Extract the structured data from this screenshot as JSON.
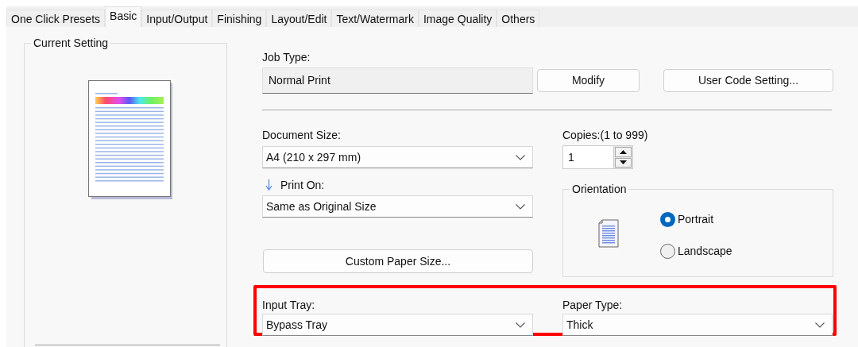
{
  "tabs": [
    {
      "label": "One Click Presets",
      "selected": false
    },
    {
      "label": "Basic",
      "selected": true
    },
    {
      "label": "Input/Output",
      "selected": false
    },
    {
      "label": "Finishing",
      "selected": false
    },
    {
      "label": "Layout/Edit",
      "selected": false
    },
    {
      "label": "Text/Watermark",
      "selected": false
    },
    {
      "label": "Image Quality",
      "selected": false
    },
    {
      "label": "Others",
      "selected": false
    }
  ],
  "current_setting": {
    "title": "Current Setting"
  },
  "job_type": {
    "label": "Job Type:",
    "value": "Normal Print",
    "buttons": [
      "Modify",
      "User Code Setting..."
    ]
  },
  "document_size": {
    "label": "Document Size:",
    "value": "A4 (210 x 297 mm)"
  },
  "copies": {
    "label": "Copies:(1 to 999)",
    "value": "1"
  },
  "print_on": {
    "label": "Print On:",
    "value": "Same as Original Size"
  },
  "custom_paper_size_button": "Custom Paper Size...",
  "orientation": {
    "title": "Orientation",
    "options": [
      {
        "label": "Portrait",
        "selected": true
      },
      {
        "label": "Landscape",
        "selected": false
      }
    ]
  },
  "input_tray": {
    "label": "Input Tray:",
    "value": "Bypass Tray"
  },
  "paper_type": {
    "label": "Paper Type:",
    "value": "Thick"
  }
}
